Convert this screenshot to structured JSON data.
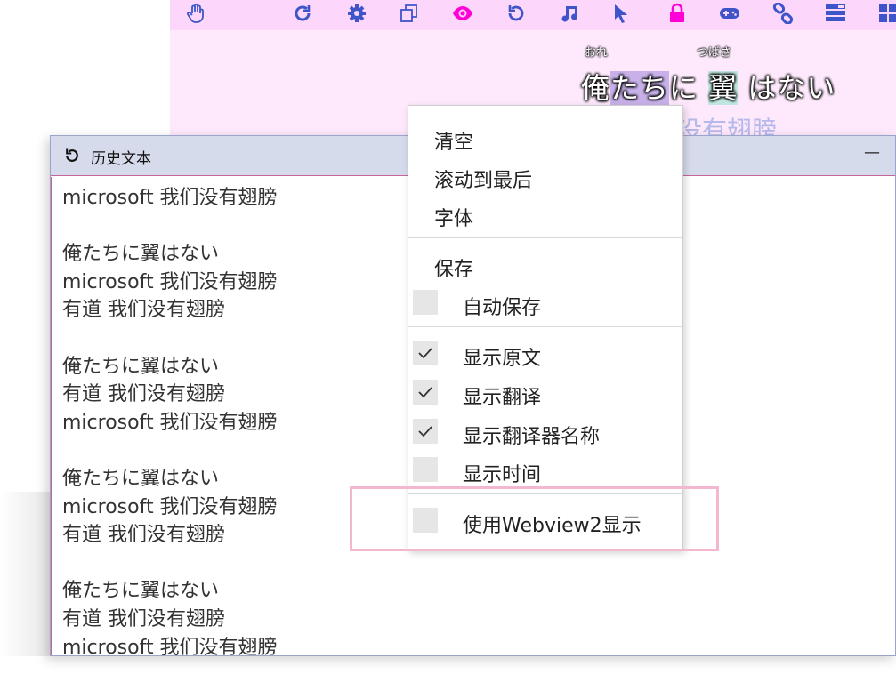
{
  "toolbar": {
    "icons": [
      "hand-icon",
      "refresh-icon",
      "gear-icon",
      "copy-icon",
      "eye-icon",
      "undo-icon",
      "music-icon",
      "cursor-icon",
      "lock-icon",
      "gamepad-icon",
      "link-icon",
      "layers-icon",
      "windows-icon"
    ],
    "accent_color": "#3d55c9",
    "highlight_color": "#ff00d8"
  },
  "overlay": {
    "ruby_1": "おれ",
    "ruby_2": "つばさ",
    "jp_1": "俺",
    "jp_2": "たち",
    "jp_3": "に ",
    "jp_4": "翼",
    "jp_5": " はない",
    "translation_partial": "没有翅膀"
  },
  "history": {
    "title": "历史文本",
    "minimize": "—",
    "entries": [
      [
        "microsoft 我们没有翅膀"
      ],
      [
        "俺たちに翼はない",
        "microsoft 我们没有翅膀",
        "有道 我们没有翅膀"
      ],
      [
        "俺たちに翼はない",
        "有道 我们没有翅膀",
        "microsoft 我们没有翅膀"
      ],
      [
        "俺たちに翼はない",
        "microsoft 我们没有翅膀",
        "有道 我们没有翅膀"
      ],
      [
        "俺たちに翼はない",
        "有道 我们没有翅膀",
        "microsoft 我们没有翅膀"
      ]
    ]
  },
  "menu": {
    "clear": "清空",
    "scroll_to_end": "滚动到最后",
    "font": "字体",
    "save": "保存",
    "auto_save": {
      "label": "自动保存",
      "checked": false
    },
    "show_original": {
      "label": "显示原文",
      "checked": true
    },
    "show_translation": {
      "label": "显示翻译",
      "checked": true
    },
    "show_translator_name": {
      "label": "显示翻译器名称",
      "checked": true
    },
    "show_time": {
      "label": "显示时间",
      "checked": false
    },
    "use_webview2": {
      "label": "使用Webview2显示",
      "checked": false
    }
  }
}
